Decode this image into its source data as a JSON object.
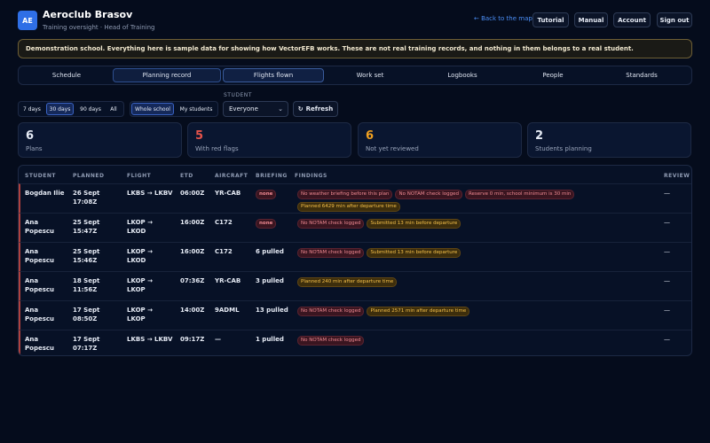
{
  "header": {
    "logo_text": "AE",
    "club_name": "Aeroclub Brasov",
    "subtitle": "Training oversight · Head of Training",
    "back_link": "← Back to the map",
    "buttons": [
      "Tutorial",
      "Manual",
      "Account",
      "Sign out"
    ]
  },
  "banner": "Demonstration school. Everything here is sample data for showing how VectorEFB works. These are not real training records, and nothing in them belongs to a real student.",
  "tabs": [
    "Schedule",
    "Planning record",
    "Flights flown",
    "Work set",
    "Logbooks",
    "People",
    "Standards"
  ],
  "filters": {
    "ranges": [
      "7 days",
      "30 days",
      "90 days",
      "All"
    ],
    "active_range": "30 days",
    "scope": [
      "Whole school",
      "My students"
    ],
    "active_scope": "Whole school",
    "student_label": "STUDENT",
    "student_value": "Everyone",
    "refresh_label": "Refresh"
  },
  "stats": [
    {
      "value": "6",
      "label": "Plans",
      "color": "#e6ebf5"
    },
    {
      "value": "5",
      "label": "With red flags",
      "color": "#e5534b"
    },
    {
      "value": "6",
      "label": "Not yet reviewed",
      "color": "#f0a020"
    },
    {
      "value": "2",
      "label": "Students planning",
      "color": "#e6ebf5"
    }
  ],
  "table": {
    "columns": [
      "STUDENT",
      "PLANNED",
      "FLIGHT",
      "ETD",
      "AIRCRAFT",
      "BRIEFING",
      "FINDINGS",
      "REVIEW"
    ],
    "rows": [
      {
        "student": [
          "Bogdan Ilie",
          ""
        ],
        "planned": [
          "26 Sept",
          "17:08Z"
        ],
        "flight": [
          "LKBS → LKBV",
          ""
        ],
        "etd": "06:00Z",
        "aircraft": "YR-CAB",
        "briefing": "none",
        "findings": [
          {
            "text": "No weather briefing before this plan",
            "kind": "red"
          },
          {
            "text": "No NOTAM check logged",
            "kind": "red"
          },
          {
            "text": "Reserve 0 min, school minimum is 30 min",
            "kind": "red"
          },
          {
            "text": "Planned 6429 min after departure time",
            "kind": "amber"
          }
        ],
        "review": "—"
      },
      {
        "student": [
          "Ana",
          "Popescu"
        ],
        "planned": [
          "25 Sept",
          "15:47Z"
        ],
        "flight": [
          "LKOP →",
          "LKOD"
        ],
        "etd": "16:00Z",
        "aircraft": "C172",
        "briefing": "none",
        "findings": [
          {
            "text": "No NOTAM check logged",
            "kind": "red"
          },
          {
            "text": "Submitted 13 min before departure",
            "kind": "amber"
          }
        ],
        "review": "—"
      },
      {
        "student": [
          "Ana",
          "Popescu"
        ],
        "planned": [
          "25 Sept",
          "15:46Z"
        ],
        "flight": [
          "LKOP →",
          "LKOD"
        ],
        "etd": "16:00Z",
        "aircraft": "C172",
        "briefing": "6 pulled",
        "findings": [
          {
            "text": "No NOTAM check logged",
            "kind": "red"
          },
          {
            "text": "Submitted 13 min before departure",
            "kind": "amber"
          }
        ],
        "review": "—"
      },
      {
        "student": [
          "Ana",
          "Popescu"
        ],
        "planned": [
          "18 Sept",
          "11:56Z"
        ],
        "flight": [
          "LKOP →",
          "LKOP"
        ],
        "etd": "07:36Z",
        "aircraft": "YR-CAB",
        "briefing": "3 pulled",
        "findings": [
          {
            "text": "Planned 240 min after departure time",
            "kind": "amber"
          }
        ],
        "review": "—"
      },
      {
        "student": [
          "Ana",
          "Popescu"
        ],
        "planned": [
          "17 Sept",
          "08:50Z"
        ],
        "flight": [
          "LKOP →",
          "LKOP"
        ],
        "etd": "14:00Z",
        "aircraft": "9ADML",
        "briefing": "13 pulled",
        "findings": [
          {
            "text": "No NOTAM check logged",
            "kind": "red"
          },
          {
            "text": "Planned 2571 min after departure time",
            "kind": "amber"
          }
        ],
        "review": "—"
      },
      {
        "student": [
          "Ana",
          "Popescu"
        ],
        "planned": [
          "17 Sept",
          "07:17Z"
        ],
        "flight": [
          "LKBS → LKBV",
          ""
        ],
        "etd": "09:17Z",
        "aircraft": "—",
        "briefing": "1 pulled",
        "findings": [
          {
            "text": "No NOTAM check logged",
            "kind": "red"
          }
        ],
        "review": "—"
      }
    ]
  }
}
